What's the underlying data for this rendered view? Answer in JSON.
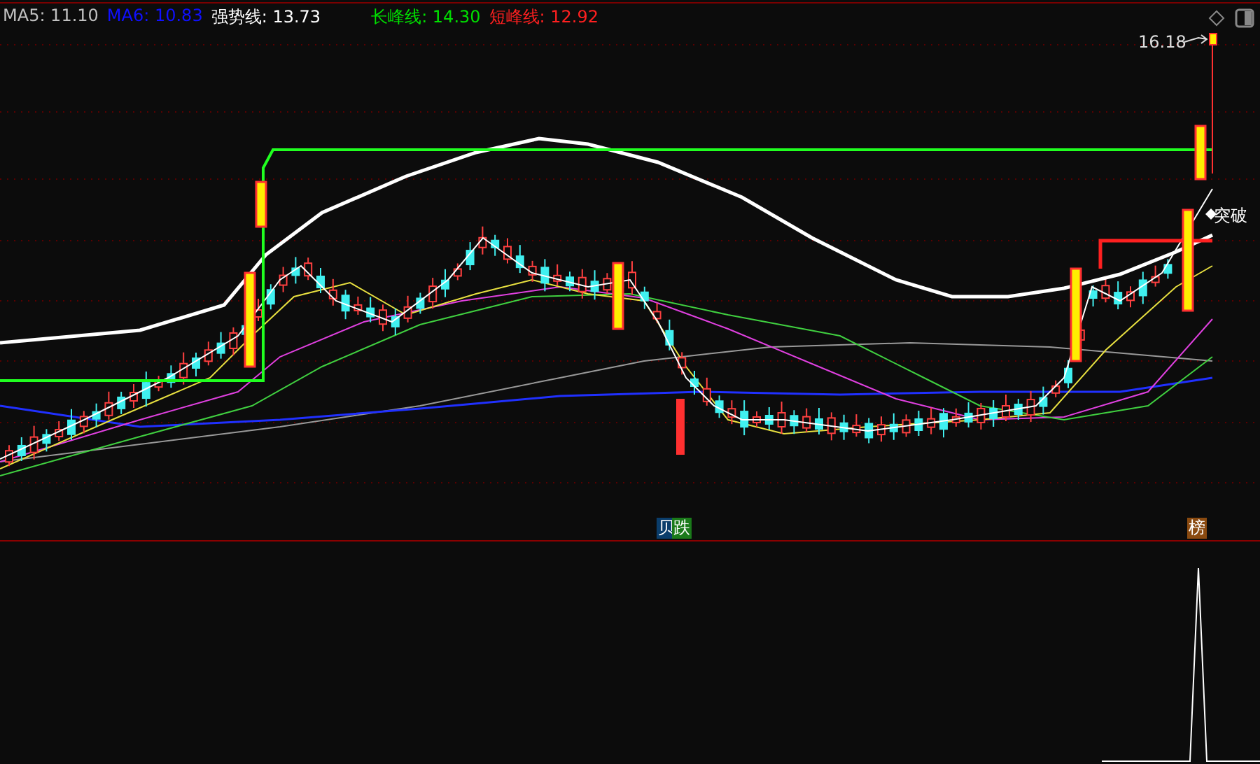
{
  "legend": [
    {
      "text": "MA5: 11.10",
      "color": "#c0c0c0"
    },
    {
      "text": "MA6: 10.83",
      "color": "#1010ff"
    },
    {
      "text": "强势线: 13.73",
      "color": "#ffffff"
    },
    {
      "text": "长峰线: 14.30",
      "color": "#00e000"
    },
    {
      "text": "短峰线: 12.92",
      "color": "#ff2020"
    }
  ],
  "price_label": "16.18",
  "signal_label": "突破",
  "markers": [
    {
      "text": "贝",
      "kind": "buy"
    },
    {
      "text": "跌",
      "kind": "fall"
    },
    {
      "text": "榜",
      "kind": "rank"
    }
  ]
}
